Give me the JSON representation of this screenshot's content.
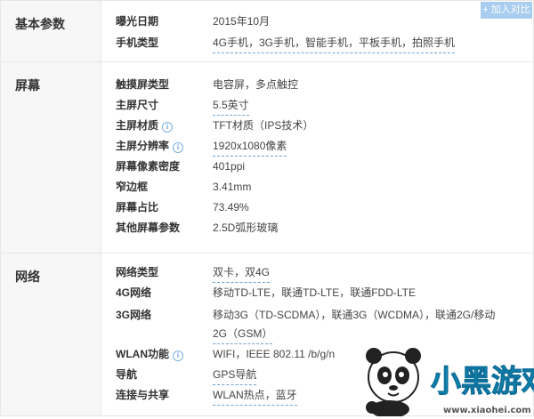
{
  "compare_button": "+ 加入对比",
  "sections": {
    "basic": {
      "title": "基本参数",
      "rows": [
        {
          "label": "曝光日期",
          "value": "2015年10月"
        },
        {
          "label": "手机类型",
          "value": "4G手机，3G手机，智能手机，平板手机，拍照手机"
        }
      ]
    },
    "screen": {
      "title": "屏幕",
      "rows": [
        {
          "label": "触摸屏类型",
          "value": "电容屏，多点触控"
        },
        {
          "label": "主屏尺寸",
          "value": "5.5英寸"
        },
        {
          "label": "主屏材质",
          "value": "TFT材质（IPS技术）"
        },
        {
          "label": "主屏分辨率",
          "value": "1920x1080像素"
        },
        {
          "label": "屏幕像素密度",
          "value": "401ppi"
        },
        {
          "label": "窄边框",
          "value": "3.41mm"
        },
        {
          "label": "屏幕占比",
          "value": "73.49%"
        },
        {
          "label": "其他屏幕参数",
          "value": "2.5D弧形玻璃"
        }
      ]
    },
    "network": {
      "title": "网络",
      "rows": [
        {
          "label": "网络类型",
          "value": "双卡，双4G"
        },
        {
          "label": "4G网络",
          "value": "移动TD-LTE，联通TD-LTE，联通FDD-LTE"
        },
        {
          "label": "3G网络",
          "value": "移动3G（TD-SCDMA），联通3G（WCDMA），联通2G/移动",
          "value2": "2G（GSM）"
        },
        {
          "label": "WLAN功能",
          "value": "WIFI，IEEE 802.11 /b/g/n"
        },
        {
          "label": "导航",
          "value": "GPS导航"
        },
        {
          "label": "连接与共享",
          "value": "WLAN热点，蓝牙"
        }
      ]
    }
  },
  "info_icon_glyph": "i",
  "watermark": {
    "logo_text": "小黑游戏",
    "url": "www.xiaohei.com"
  },
  "colors": {
    "accent": "#5a9ad6",
    "compare_button": "#a8cdee",
    "category_bg": "#f7f7f7",
    "border": "#e6e6e6"
  }
}
